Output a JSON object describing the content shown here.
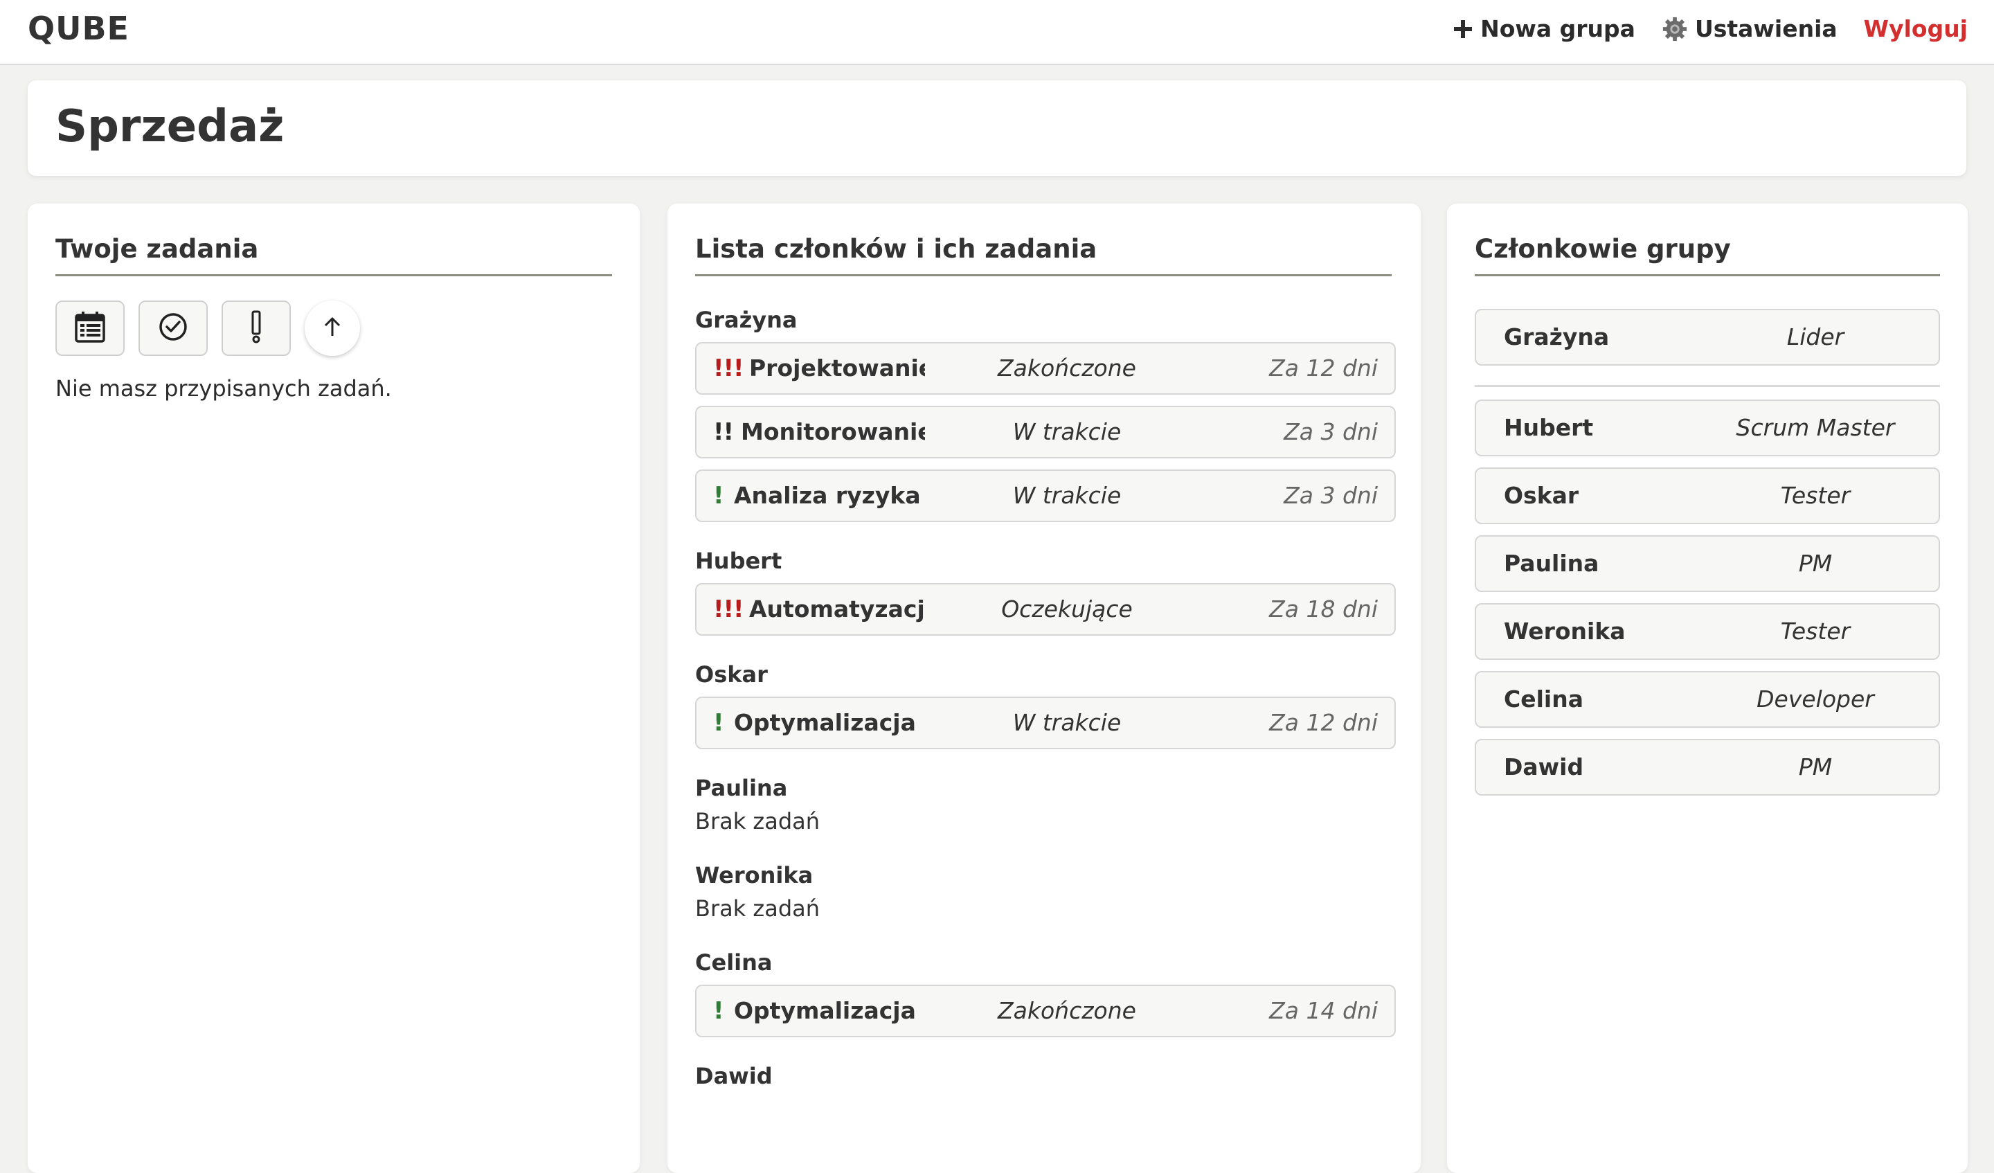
{
  "app": {
    "logo": "QUBE"
  },
  "nav": {
    "new_group": "Nowa grupa",
    "settings": "Ustawienia",
    "logout": "Wyloguj"
  },
  "group": {
    "title": "Sprzedaż"
  },
  "colors": {
    "priority_high": "#b71c1c",
    "priority_medium": "#e0a130",
    "priority_low": "#2e7d32",
    "logout": "#d32f2f"
  },
  "my_tasks": {
    "title": "Twoje zadania",
    "filters": [
      {
        "icon": "calendar-icon"
      },
      {
        "icon": "check-circle-icon"
      },
      {
        "icon": "exclamation-icon"
      },
      {
        "icon": "arrow-up-icon"
      }
    ],
    "empty_message": "Nie masz przypisanych zadań."
  },
  "members_tasks": {
    "title": "Lista członków i ich zadania",
    "members": [
      {
        "name": "Grażyna",
        "tasks": [
          {
            "priority": "!!!",
            "level": "high",
            "name": "Projektowanie b",
            "status": "Zakończone",
            "due": "Za 12 dni"
          },
          {
            "priority": "!!",
            "level": "medium",
            "name": "Monitorowanie s",
            "status": "W trakcie",
            "due": "Za 3 dni"
          },
          {
            "priority": "!",
            "level": "low",
            "name": "Analiza ryzyka",
            "status": "W trakcie",
            "due": "Za 3 dni"
          }
        ]
      },
      {
        "name": "Hubert",
        "tasks": [
          {
            "priority": "!!!",
            "level": "high",
            "name": "Automatyzacja p",
            "status": "Oczekujące",
            "due": "Za 18 dni"
          }
        ]
      },
      {
        "name": "Oskar",
        "tasks": [
          {
            "priority": "!",
            "level": "low",
            "name": "Optymalizacja log",
            "status": "W trakcie",
            "due": "Za 12 dni"
          }
        ]
      },
      {
        "name": "Paulina",
        "tasks": [],
        "empty": "Brak zadań"
      },
      {
        "name": "Weronika",
        "tasks": [],
        "empty": "Brak zadań"
      },
      {
        "name": "Celina",
        "tasks": [
          {
            "priority": "!",
            "level": "low",
            "name": "Optymalizacja SE",
            "status": "Zakończone",
            "due": "Za 14 dni"
          }
        ]
      },
      {
        "name": "Dawid",
        "tasks": []
      }
    ]
  },
  "group_members": {
    "title": "Członkowie grupy",
    "leader": {
      "name": "Grażyna",
      "role": "Lider"
    },
    "members": [
      {
        "name": "Hubert",
        "role": "Scrum Master"
      },
      {
        "name": "Oskar",
        "role": "Tester"
      },
      {
        "name": "Paulina",
        "role": "PM"
      },
      {
        "name": "Weronika",
        "role": "Tester"
      },
      {
        "name": "Celina",
        "role": "Developer"
      },
      {
        "name": "Dawid",
        "role": "PM"
      }
    ]
  }
}
